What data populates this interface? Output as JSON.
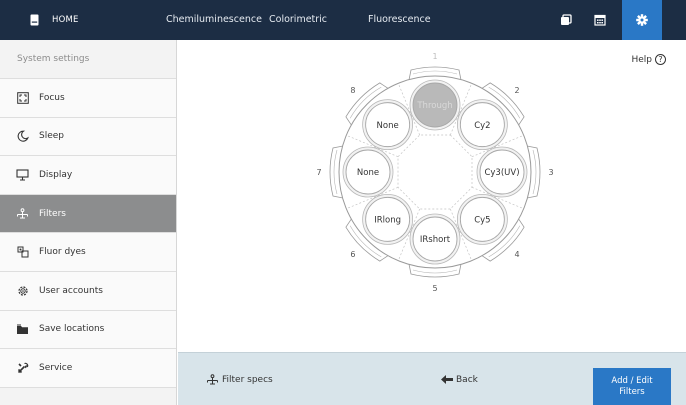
{
  "topbar": {
    "home_label": "HOME",
    "nav": [
      "Chemiluminescence",
      "Colorimetric",
      "Fluorescence"
    ],
    "icons": [
      "gallery-icon",
      "calendar-icon",
      "settings-gear-icon"
    ],
    "active_icon": "settings-gear-icon"
  },
  "sidebar": {
    "title": "System settings",
    "items": [
      {
        "label": "Focus",
        "icon": "focus-icon"
      },
      {
        "label": "Sleep",
        "icon": "moon-icon"
      },
      {
        "label": "Display",
        "icon": "monitor-icon"
      },
      {
        "label": "Filters",
        "icon": "filter-icon",
        "active": true
      },
      {
        "label": "Fluor dyes",
        "icon": "dyes-icon"
      },
      {
        "label": "User accounts",
        "icon": "users-gear-icon"
      },
      {
        "label": "Save locations",
        "icon": "folder-icon"
      },
      {
        "label": "Service",
        "icon": "tools-icon"
      }
    ]
  },
  "main": {
    "help_label": "Help",
    "wheel": {
      "positions": [
        {
          "num": "1",
          "filter": "Through"
        },
        {
          "num": "2",
          "filter": "Cy2"
        },
        {
          "num": "3",
          "filter": "Cy3(UV)"
        },
        {
          "num": "4",
          "filter": "Cy5"
        },
        {
          "num": "5",
          "filter": "IRshort"
        },
        {
          "num": "6",
          "filter": "IRlong"
        },
        {
          "num": "7",
          "filter": "None"
        },
        {
          "num": "8",
          "filter": "None"
        }
      ]
    }
  },
  "bottombar": {
    "filter_specs_label": "Filter specs",
    "back_label": "Back",
    "add_edit_label": "Add / Edit Filters"
  },
  "colors": {
    "topbar_bg": "#1c2d44",
    "accent": "#2a78c6",
    "sidebar_active": "#8c8d8e",
    "bottombar_bg": "#d8e4ea"
  }
}
